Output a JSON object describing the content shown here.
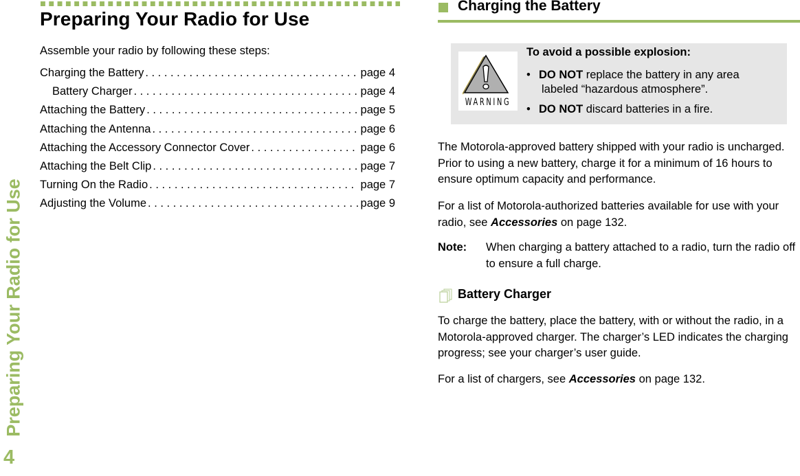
{
  "side_tab": {
    "title": "Preparing Your Radio for Use",
    "page_number": "4"
  },
  "left": {
    "title": "Preparing Your Radio for Use",
    "intro": "Assemble your radio by following these steps:",
    "toc": [
      {
        "label": "Charging the Battery",
        "page": "page 4",
        "indent": false
      },
      {
        "label": "Battery Charger",
        "page": "page 4",
        "indent": true
      },
      {
        "label": "Attaching the Battery",
        "page": "page 5",
        "indent": false
      },
      {
        "label": "Attaching the Antenna",
        "page": "page 6",
        "indent": false
      },
      {
        "label": "Attaching the Accessory Connector Cover",
        "page": "page 6",
        "indent": false
      },
      {
        "label": "Attaching the Belt Clip",
        "page": "page 7",
        "indent": false
      },
      {
        "label": "Turning On the Radio",
        "page": "page 7",
        "indent": false
      },
      {
        "label": "Adjusting the Volume",
        "page": "page 9",
        "indent": false
      }
    ]
  },
  "right": {
    "section_title": "Charging the Battery",
    "warning": {
      "icon_label": "WARNING",
      "heading": "To avoid a possible explosion:",
      "items": [
        {
          "bullet": "•",
          "bold": "DO NOT",
          "text": " replace the battery in any area",
          "text2": "labeled “hazardous atmosphere”."
        },
        {
          "bullet": "•",
          "bold": "DO NOT",
          "text": " discard batteries in a fire."
        }
      ]
    },
    "para1": "The Motorola-approved battery shipped with your radio is uncharged. Prior to using a new battery, charge it for a minimum of 16 hours to ensure optimum capacity and performance.",
    "para2": {
      "before": "For a list of Motorola-authorized batteries available for use with your radio, see ",
      "link": "Accessories",
      "after": " on page 132."
    },
    "note": {
      "label": "Note:",
      "text": "When charging a battery attached to a radio, turn the radio off to ensure a full charge."
    },
    "subsection_title": "Battery Charger",
    "para3": "To charge the battery, place the battery, with or without the radio, in a Motorola-approved charger. The charger’s LED indicates the charging progress; see your charger’s user guide.",
    "para4": {
      "before": "For a list of chargers, see ",
      "link": "Accessories",
      "after": " on page 132."
    }
  },
  "colors": {
    "accent": "#9bbb63",
    "warning_bg": "#e6e6e6"
  }
}
